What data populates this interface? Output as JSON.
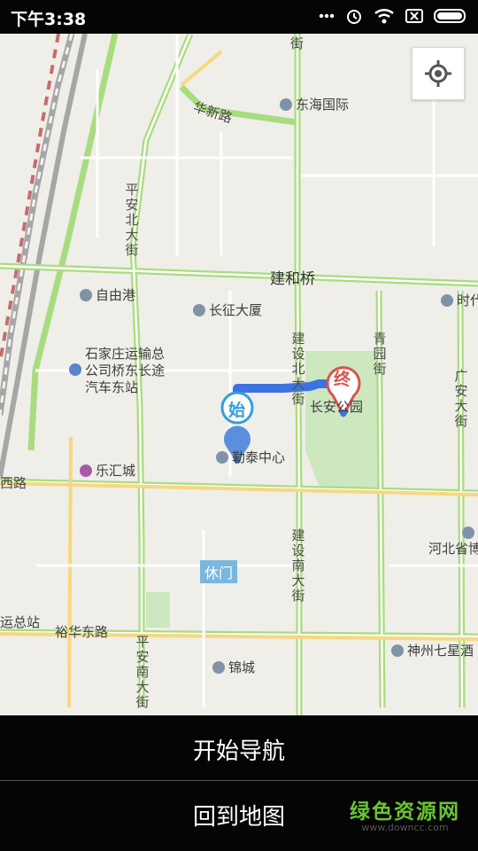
{
  "status": {
    "time": "下午3:38",
    "icons": [
      "more-icon",
      "alarm-icon",
      "wifi-icon",
      "sim-off-icon",
      "battery-icon"
    ]
  },
  "map": {
    "roads": {
      "huaxin": "华新路",
      "jianhe": "建和桥",
      "yuhua": "裕华东路",
      "xiroad": "西路",
      "pinganbei": "平安北大街",
      "pinganan": "平安南大街",
      "jianshebei": "建设北大街",
      "jianshenan": "建设南大街",
      "qingyuan": "青园街",
      "guangan": "广安大街",
      "street_top": "街"
    },
    "pois": {
      "donghai": "东海国际",
      "ziyougang": "自由港",
      "changzheng": "长征大厦",
      "transport": "石家庄运输总公司桥东长途汽车东站",
      "transport_lines": [
        "石家庄运输总",
        "公司桥东长途",
        "汽车东站"
      ],
      "lehui": "乐汇城",
      "yongtai": "勒泰中心",
      "changan_park": "长安公园",
      "hebei": "河北省博",
      "shenzhou": "神州七星酒",
      "jincheng": "锦城",
      "shidai": "时代",
      "station": "运总站",
      "xiumen": "休门"
    },
    "markers": {
      "start": "始",
      "end": "终"
    },
    "colors": {
      "route": "#3d73e0",
      "major_road": "#a9dc7e",
      "secondary_road": "#f5d880",
      "start": "#2f9fde",
      "end": "#d9534f",
      "park": "#cde7bf"
    }
  },
  "actions": {
    "start_nav": "开始导航",
    "back_to_map": "回到地图"
  },
  "watermark": {
    "main": "绿色资源网",
    "sub": "www.downcc.com"
  }
}
